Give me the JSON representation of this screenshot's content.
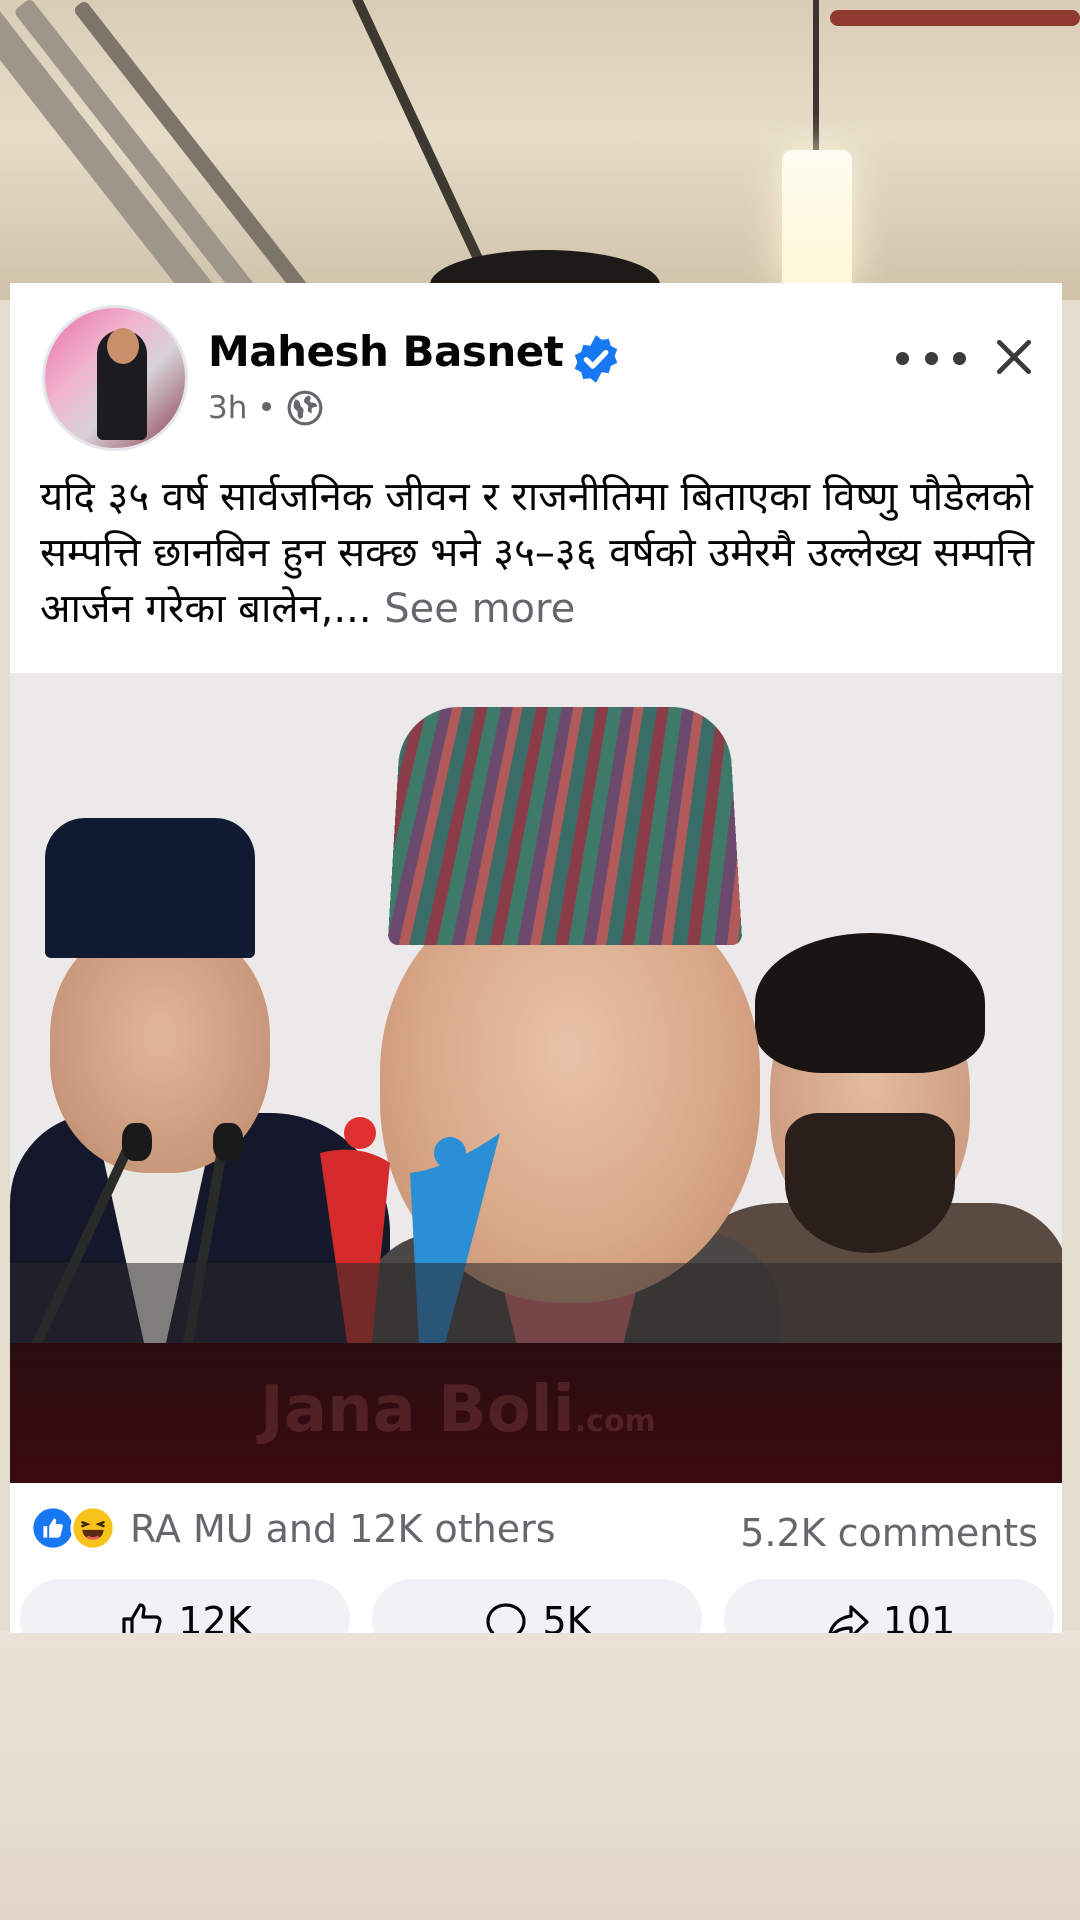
{
  "post": {
    "author": "Mahesh Basnet",
    "time": "3h",
    "separator": "•",
    "text": "यदि ३५ वर्ष सार्वजनिक जीवन र राजनीतिमा बिताएका विष्णु पौडेलको सम्पत्ति छानबिन हुन सक्छ भने ३५–३६ वर्षको उमेरमै उल्लेख्य सम्पत्ति आर्जन गरेका बालेन,...",
    "see_more": "See more"
  },
  "image": {
    "watermark": "Jana Boli",
    "watermark_suffix": ".com"
  },
  "reactions": {
    "summary": "RA MU and 12K others",
    "comments": "5.2K comments"
  },
  "actions": {
    "like_count": "12K",
    "comment_count": "5K",
    "share_count": "101"
  },
  "colors": {
    "verified_blue": "#1877f2",
    "secondary_text": "#65676b",
    "primary_text": "#050505"
  }
}
